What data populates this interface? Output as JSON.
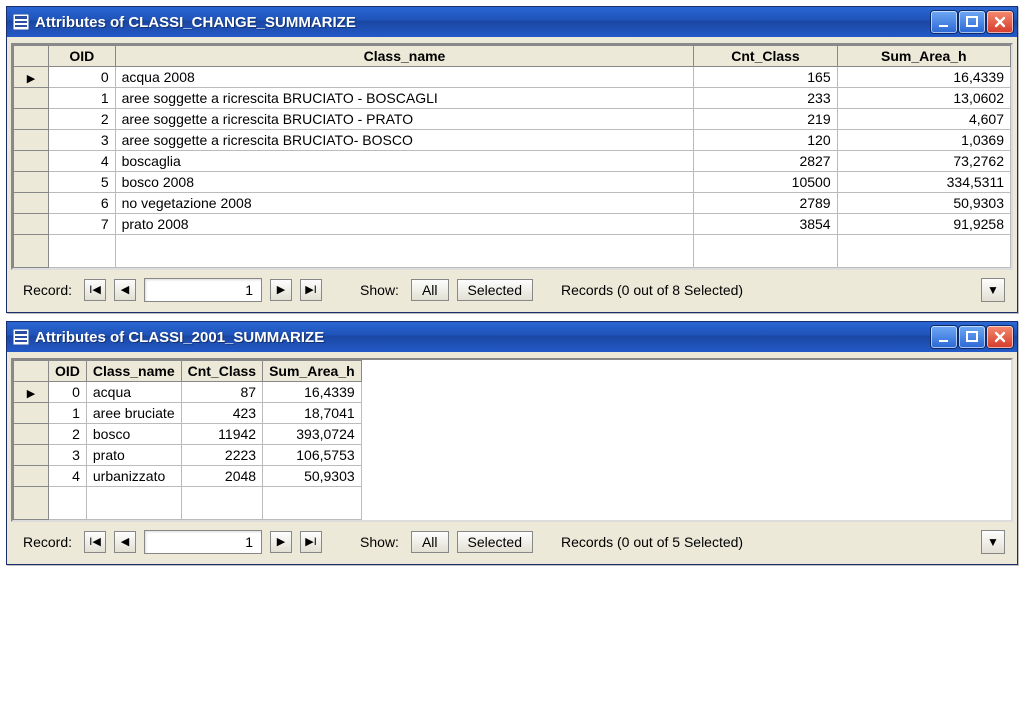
{
  "windows": [
    {
      "title": "Attributes of CLASSI_CHANGE_SUMMARIZE",
      "columns": [
        "OID",
        "Class_name",
        "Cnt_Class",
        "Sum_Area_h"
      ],
      "col_align": [
        "right",
        "left",
        "right",
        "right"
      ],
      "rows": [
        {
          "oid": "0",
          "class_name": "acqua 2008",
          "cnt": "165",
          "sum": "16,4339",
          "selected": true
        },
        {
          "oid": "1",
          "class_name": "aree soggette a ricrescita BRUCIATO - BOSCAGLI",
          "cnt": "233",
          "sum": "13,0602"
        },
        {
          "oid": "2",
          "class_name": "aree soggette a ricrescita BRUCIATO - PRATO",
          "cnt": "219",
          "sum": "4,607"
        },
        {
          "oid": "3",
          "class_name": "aree soggette a ricrescita BRUCIATO- BOSCO",
          "cnt": "120",
          "sum": "1,0369"
        },
        {
          "oid": "4",
          "class_name": "boscaglia",
          "cnt": "2827",
          "sum": "73,2762"
        },
        {
          "oid": "5",
          "class_name": "bosco 2008",
          "cnt": "10500",
          "sum": "334,5311"
        },
        {
          "oid": "6",
          "class_name": "no vegetazione 2008",
          "cnt": "2789",
          "sum": "50,9303"
        },
        {
          "oid": "7",
          "class_name": "prato 2008",
          "cnt": "3854",
          "sum": "91,9258"
        }
      ],
      "status": {
        "record_label": "Record:",
        "record_value": "1",
        "show_label": "Show:",
        "all_label": "All",
        "selected_label": "Selected",
        "records_text": "Records (0 out of 8 Selected)"
      }
    },
    {
      "title": "Attributes of CLASSI_2001_SUMMARIZE",
      "columns": [
        "OID",
        "Class_name",
        "Cnt_Class",
        "Sum_Area_h"
      ],
      "col_align": [
        "right",
        "left",
        "right",
        "right"
      ],
      "rows": [
        {
          "oid": "0",
          "class_name": "acqua",
          "cnt": "87",
          "sum": "16,4339",
          "selected": true
        },
        {
          "oid": "1",
          "class_name": "aree bruciate",
          "cnt": "423",
          "sum": "18,7041"
        },
        {
          "oid": "2",
          "class_name": "bosco",
          "cnt": "11942",
          "sum": "393,0724"
        },
        {
          "oid": "3",
          "class_name": "prato",
          "cnt": "2223",
          "sum": "106,5753"
        },
        {
          "oid": "4",
          "class_name": "urbanizzato",
          "cnt": "2048",
          "sum": "50,9303"
        }
      ],
      "status": {
        "record_label": "Record:",
        "record_value": "1",
        "show_label": "Show:",
        "all_label": "All",
        "selected_label": "Selected",
        "records_text": "Records (0 out of 5 Selected)"
      },
      "narrow": true
    }
  ],
  "icons": {
    "first": "I◀",
    "prev": "◀",
    "next": "▶",
    "last": "▶I",
    "dropdown": "▼"
  }
}
